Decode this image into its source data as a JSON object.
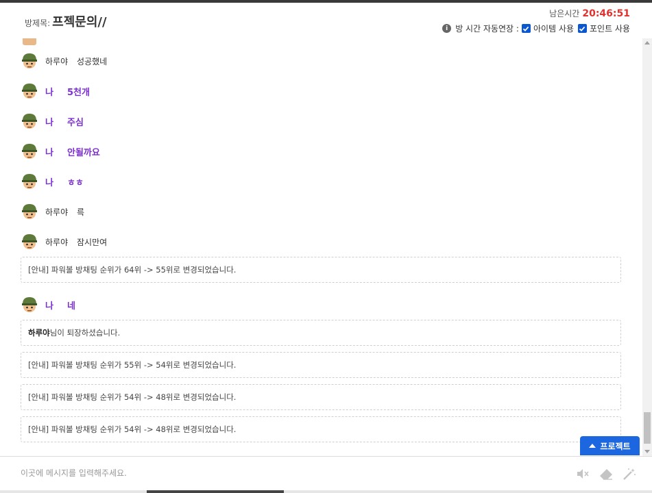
{
  "header": {
    "room_title_label": "방제목:",
    "room_title": "프젝문의//",
    "remain_label": "남은시간",
    "remain_time": "20:46:51",
    "auto_extend_label": "방 시간 자동연장 :",
    "item_use_label": "아이템 사용",
    "point_use_label": "포인트 사용"
  },
  "messages": [
    {
      "nick": "하루야",
      "text": "성공했네",
      "me": false
    },
    {
      "nick": "나",
      "text": "5천개",
      "me": true
    },
    {
      "nick": "나",
      "text": "주심",
      "me": true
    },
    {
      "nick": "나",
      "text": "안될까요",
      "me": true
    },
    {
      "nick": "나",
      "text": "ㅎㅎ",
      "me": true
    },
    {
      "nick": "하루야",
      "text": "륵",
      "me": false
    },
    {
      "nick": "하루야",
      "text": "잠시만여",
      "me": false
    },
    {
      "nick": "나",
      "text": "네",
      "me": true
    }
  ],
  "notices": [
    {
      "text": "[안내] 파워볼 방채팅 순위가 64위 -> 55위로 변경되었습니다."
    },
    {
      "bold": "하루야",
      "text": "님이 퇴장하셨습니다."
    },
    {
      "text": "[안내] 파워볼 방채팅 순위가 55위 -> 54위로 변경되었습니다."
    },
    {
      "text": "[안내] 파워볼 방채팅 순위가 54위 -> 48위로 변경되었습니다."
    },
    {
      "text": "[안내] 파워볼 방채팅 순위가 54위 -> 48위로 변경되었습니다."
    }
  ],
  "project_button": "프로젝트",
  "input": {
    "placeholder": "이곳에 메시지를 입력해주세요."
  },
  "icons": {
    "mute": "mute-icon",
    "eraser": "eraser-icon",
    "magic": "magic-wand-icon"
  },
  "colors": {
    "accent": "#1c66e0",
    "my_message": "#7b2fd1",
    "timer": "#e0322e"
  }
}
